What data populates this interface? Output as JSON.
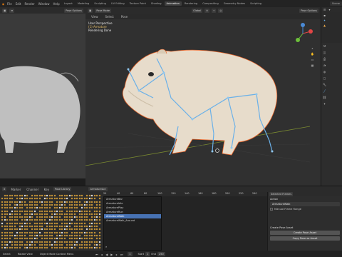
{
  "menus": [
    "File",
    "Edit",
    "Render",
    "Window",
    "Help"
  ],
  "workspaces": [
    "Layout",
    "Modeling",
    "Sculpting",
    "UV Editing",
    "Texture Paint",
    "Shading",
    "Animation",
    "Rendering",
    "Compositing",
    "Geometry Nodes",
    "Scripting"
  ],
  "active_workspace": "Animation",
  "scene_label": "Scene",
  "main_viewport": {
    "mode": "Pose Mode",
    "menus": [
      "View",
      "Select",
      "Pose"
    ],
    "transform": "Global",
    "overlay_line1": "User Perspective",
    "overlay_line2": "(1) Armature",
    "overlay_line3": "Rendering Done",
    "options_label": "Pose Options"
  },
  "left_viewport": {
    "options_label": "Pose Options"
  },
  "dopesheet": {
    "header": [
      "Marker",
      "Channel",
      "Key"
    ],
    "mode": "Pose Library",
    "action_label": "ArmatureAct",
    "frame_numbers": [
      "20",
      "40",
      "60",
      "80",
      "100",
      "120",
      "140",
      "160",
      "180",
      "200",
      "220",
      "240"
    ],
    "action_list": [
      "ArmatureBar",
      "ArmatureIdle",
      "ArmaturePlay",
      "ArmatureRun",
      "ArmatureWalk",
      "ArmatureWalk_Around"
    ],
    "selected_action": "ArmatureWalk",
    "search_icon": "search-icon"
  },
  "asset_panel": {
    "tab": "Selected Frames",
    "section_action": "Action",
    "action_value": "ArmatureWalk",
    "manual_frame_range": "Manual Frame Range",
    "new_action": "Create Pose Asset",
    "create_pose_asset": "Create Pose Asset",
    "copy_pose_as_asset": "Copy Pose as Asset"
  },
  "playback": {
    "start_label": "Start",
    "start_value": "1",
    "end_label": "End",
    "end_value": "250",
    "current_frame": "1"
  },
  "statusbar": {
    "select": "Select",
    "rotate": "Rotate View",
    "menu": "Object Mode Context Menu"
  },
  "colors": {
    "accent": "#4772b3",
    "keyframe": "#e0a63a",
    "bone": "#6ab0e8",
    "selected_outline": "#e8652a"
  }
}
